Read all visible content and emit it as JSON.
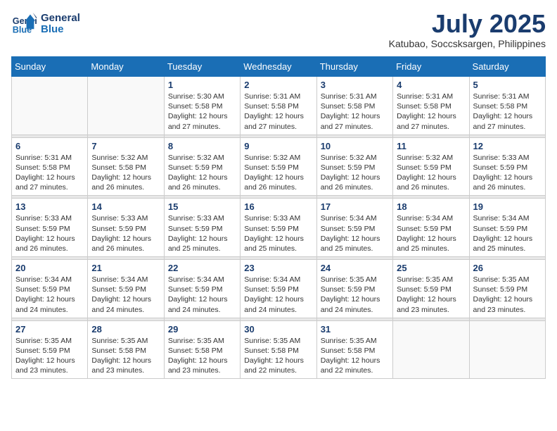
{
  "header": {
    "logo_line1": "General",
    "logo_line2": "Blue",
    "month_year": "July 2025",
    "location": "Katubao, Soccsksargen, Philippines"
  },
  "weekdays": [
    "Sunday",
    "Monday",
    "Tuesday",
    "Wednesday",
    "Thursday",
    "Friday",
    "Saturday"
  ],
  "weeks": [
    [
      {
        "num": "",
        "sunrise": "",
        "sunset": "",
        "daylight": "",
        "empty": true
      },
      {
        "num": "",
        "sunrise": "",
        "sunset": "",
        "daylight": "",
        "empty": true
      },
      {
        "num": "1",
        "sunrise": "Sunrise: 5:30 AM",
        "sunset": "Sunset: 5:58 PM",
        "daylight": "Daylight: 12 hours and 27 minutes."
      },
      {
        "num": "2",
        "sunrise": "Sunrise: 5:31 AM",
        "sunset": "Sunset: 5:58 PM",
        "daylight": "Daylight: 12 hours and 27 minutes."
      },
      {
        "num": "3",
        "sunrise": "Sunrise: 5:31 AM",
        "sunset": "Sunset: 5:58 PM",
        "daylight": "Daylight: 12 hours and 27 minutes."
      },
      {
        "num": "4",
        "sunrise": "Sunrise: 5:31 AM",
        "sunset": "Sunset: 5:58 PM",
        "daylight": "Daylight: 12 hours and 27 minutes."
      },
      {
        "num": "5",
        "sunrise": "Sunrise: 5:31 AM",
        "sunset": "Sunset: 5:58 PM",
        "daylight": "Daylight: 12 hours and 27 minutes."
      }
    ],
    [
      {
        "num": "6",
        "sunrise": "Sunrise: 5:31 AM",
        "sunset": "Sunset: 5:58 PM",
        "daylight": "Daylight: 12 hours and 27 minutes."
      },
      {
        "num": "7",
        "sunrise": "Sunrise: 5:32 AM",
        "sunset": "Sunset: 5:58 PM",
        "daylight": "Daylight: 12 hours and 26 minutes."
      },
      {
        "num": "8",
        "sunrise": "Sunrise: 5:32 AM",
        "sunset": "Sunset: 5:59 PM",
        "daylight": "Daylight: 12 hours and 26 minutes."
      },
      {
        "num": "9",
        "sunrise": "Sunrise: 5:32 AM",
        "sunset": "Sunset: 5:59 PM",
        "daylight": "Daylight: 12 hours and 26 minutes."
      },
      {
        "num": "10",
        "sunrise": "Sunrise: 5:32 AM",
        "sunset": "Sunset: 5:59 PM",
        "daylight": "Daylight: 12 hours and 26 minutes."
      },
      {
        "num": "11",
        "sunrise": "Sunrise: 5:32 AM",
        "sunset": "Sunset: 5:59 PM",
        "daylight": "Daylight: 12 hours and 26 minutes."
      },
      {
        "num": "12",
        "sunrise": "Sunrise: 5:33 AM",
        "sunset": "Sunset: 5:59 PM",
        "daylight": "Daylight: 12 hours and 26 minutes."
      }
    ],
    [
      {
        "num": "13",
        "sunrise": "Sunrise: 5:33 AM",
        "sunset": "Sunset: 5:59 PM",
        "daylight": "Daylight: 12 hours and 26 minutes."
      },
      {
        "num": "14",
        "sunrise": "Sunrise: 5:33 AM",
        "sunset": "Sunset: 5:59 PM",
        "daylight": "Daylight: 12 hours and 26 minutes."
      },
      {
        "num": "15",
        "sunrise": "Sunrise: 5:33 AM",
        "sunset": "Sunset: 5:59 PM",
        "daylight": "Daylight: 12 hours and 25 minutes."
      },
      {
        "num": "16",
        "sunrise": "Sunrise: 5:33 AM",
        "sunset": "Sunset: 5:59 PM",
        "daylight": "Daylight: 12 hours and 25 minutes."
      },
      {
        "num": "17",
        "sunrise": "Sunrise: 5:34 AM",
        "sunset": "Sunset: 5:59 PM",
        "daylight": "Daylight: 12 hours and 25 minutes."
      },
      {
        "num": "18",
        "sunrise": "Sunrise: 5:34 AM",
        "sunset": "Sunset: 5:59 PM",
        "daylight": "Daylight: 12 hours and 25 minutes."
      },
      {
        "num": "19",
        "sunrise": "Sunrise: 5:34 AM",
        "sunset": "Sunset: 5:59 PM",
        "daylight": "Daylight: 12 hours and 25 minutes."
      }
    ],
    [
      {
        "num": "20",
        "sunrise": "Sunrise: 5:34 AM",
        "sunset": "Sunset: 5:59 PM",
        "daylight": "Daylight: 12 hours and 24 minutes."
      },
      {
        "num": "21",
        "sunrise": "Sunrise: 5:34 AM",
        "sunset": "Sunset: 5:59 PM",
        "daylight": "Daylight: 12 hours and 24 minutes."
      },
      {
        "num": "22",
        "sunrise": "Sunrise: 5:34 AM",
        "sunset": "Sunset: 5:59 PM",
        "daylight": "Daylight: 12 hours and 24 minutes."
      },
      {
        "num": "23",
        "sunrise": "Sunrise: 5:34 AM",
        "sunset": "Sunset: 5:59 PM",
        "daylight": "Daylight: 12 hours and 24 minutes."
      },
      {
        "num": "24",
        "sunrise": "Sunrise: 5:35 AM",
        "sunset": "Sunset: 5:59 PM",
        "daylight": "Daylight: 12 hours and 24 minutes."
      },
      {
        "num": "25",
        "sunrise": "Sunrise: 5:35 AM",
        "sunset": "Sunset: 5:59 PM",
        "daylight": "Daylight: 12 hours and 23 minutes."
      },
      {
        "num": "26",
        "sunrise": "Sunrise: 5:35 AM",
        "sunset": "Sunset: 5:59 PM",
        "daylight": "Daylight: 12 hours and 23 minutes."
      }
    ],
    [
      {
        "num": "27",
        "sunrise": "Sunrise: 5:35 AM",
        "sunset": "Sunset: 5:59 PM",
        "daylight": "Daylight: 12 hours and 23 minutes."
      },
      {
        "num": "28",
        "sunrise": "Sunrise: 5:35 AM",
        "sunset": "Sunset: 5:58 PM",
        "daylight": "Daylight: 12 hours and 23 minutes."
      },
      {
        "num": "29",
        "sunrise": "Sunrise: 5:35 AM",
        "sunset": "Sunset: 5:58 PM",
        "daylight": "Daylight: 12 hours and 23 minutes."
      },
      {
        "num": "30",
        "sunrise": "Sunrise: 5:35 AM",
        "sunset": "Sunset: 5:58 PM",
        "daylight": "Daylight: 12 hours and 22 minutes."
      },
      {
        "num": "31",
        "sunrise": "Sunrise: 5:35 AM",
        "sunset": "Sunset: 5:58 PM",
        "daylight": "Daylight: 12 hours and 22 minutes."
      },
      {
        "num": "",
        "sunrise": "",
        "sunset": "",
        "daylight": "",
        "empty": true
      },
      {
        "num": "",
        "sunrise": "",
        "sunset": "",
        "daylight": "",
        "empty": true
      }
    ]
  ]
}
